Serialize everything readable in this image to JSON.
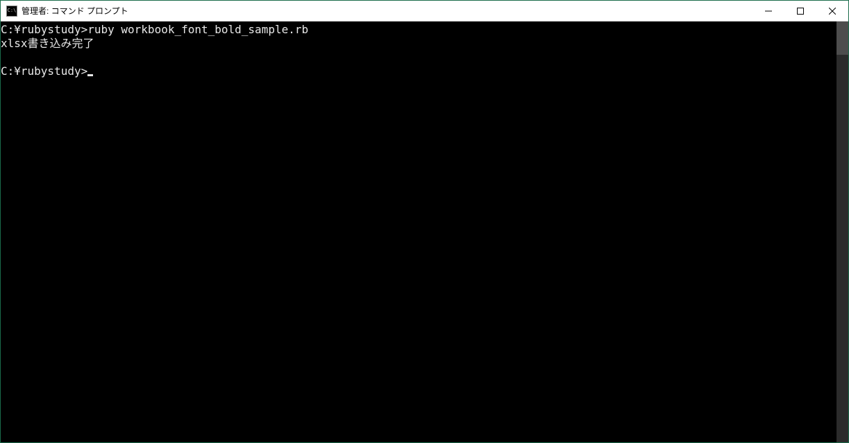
{
  "window": {
    "title": "管理者: コマンド プロンプト",
    "icon_label": "C:\\"
  },
  "console": {
    "lines": [
      {
        "prompt": "C:¥rubystudy>",
        "command": "ruby workbook_font_bold_sample.rb"
      },
      {
        "output": "xlsx書き込み完了"
      },
      {
        "blank": ""
      },
      {
        "prompt": "C:¥rubystudy>",
        "cursor": true
      }
    ]
  },
  "controls": {
    "minimize": "minimize",
    "maximize": "maximize",
    "close": "close"
  }
}
